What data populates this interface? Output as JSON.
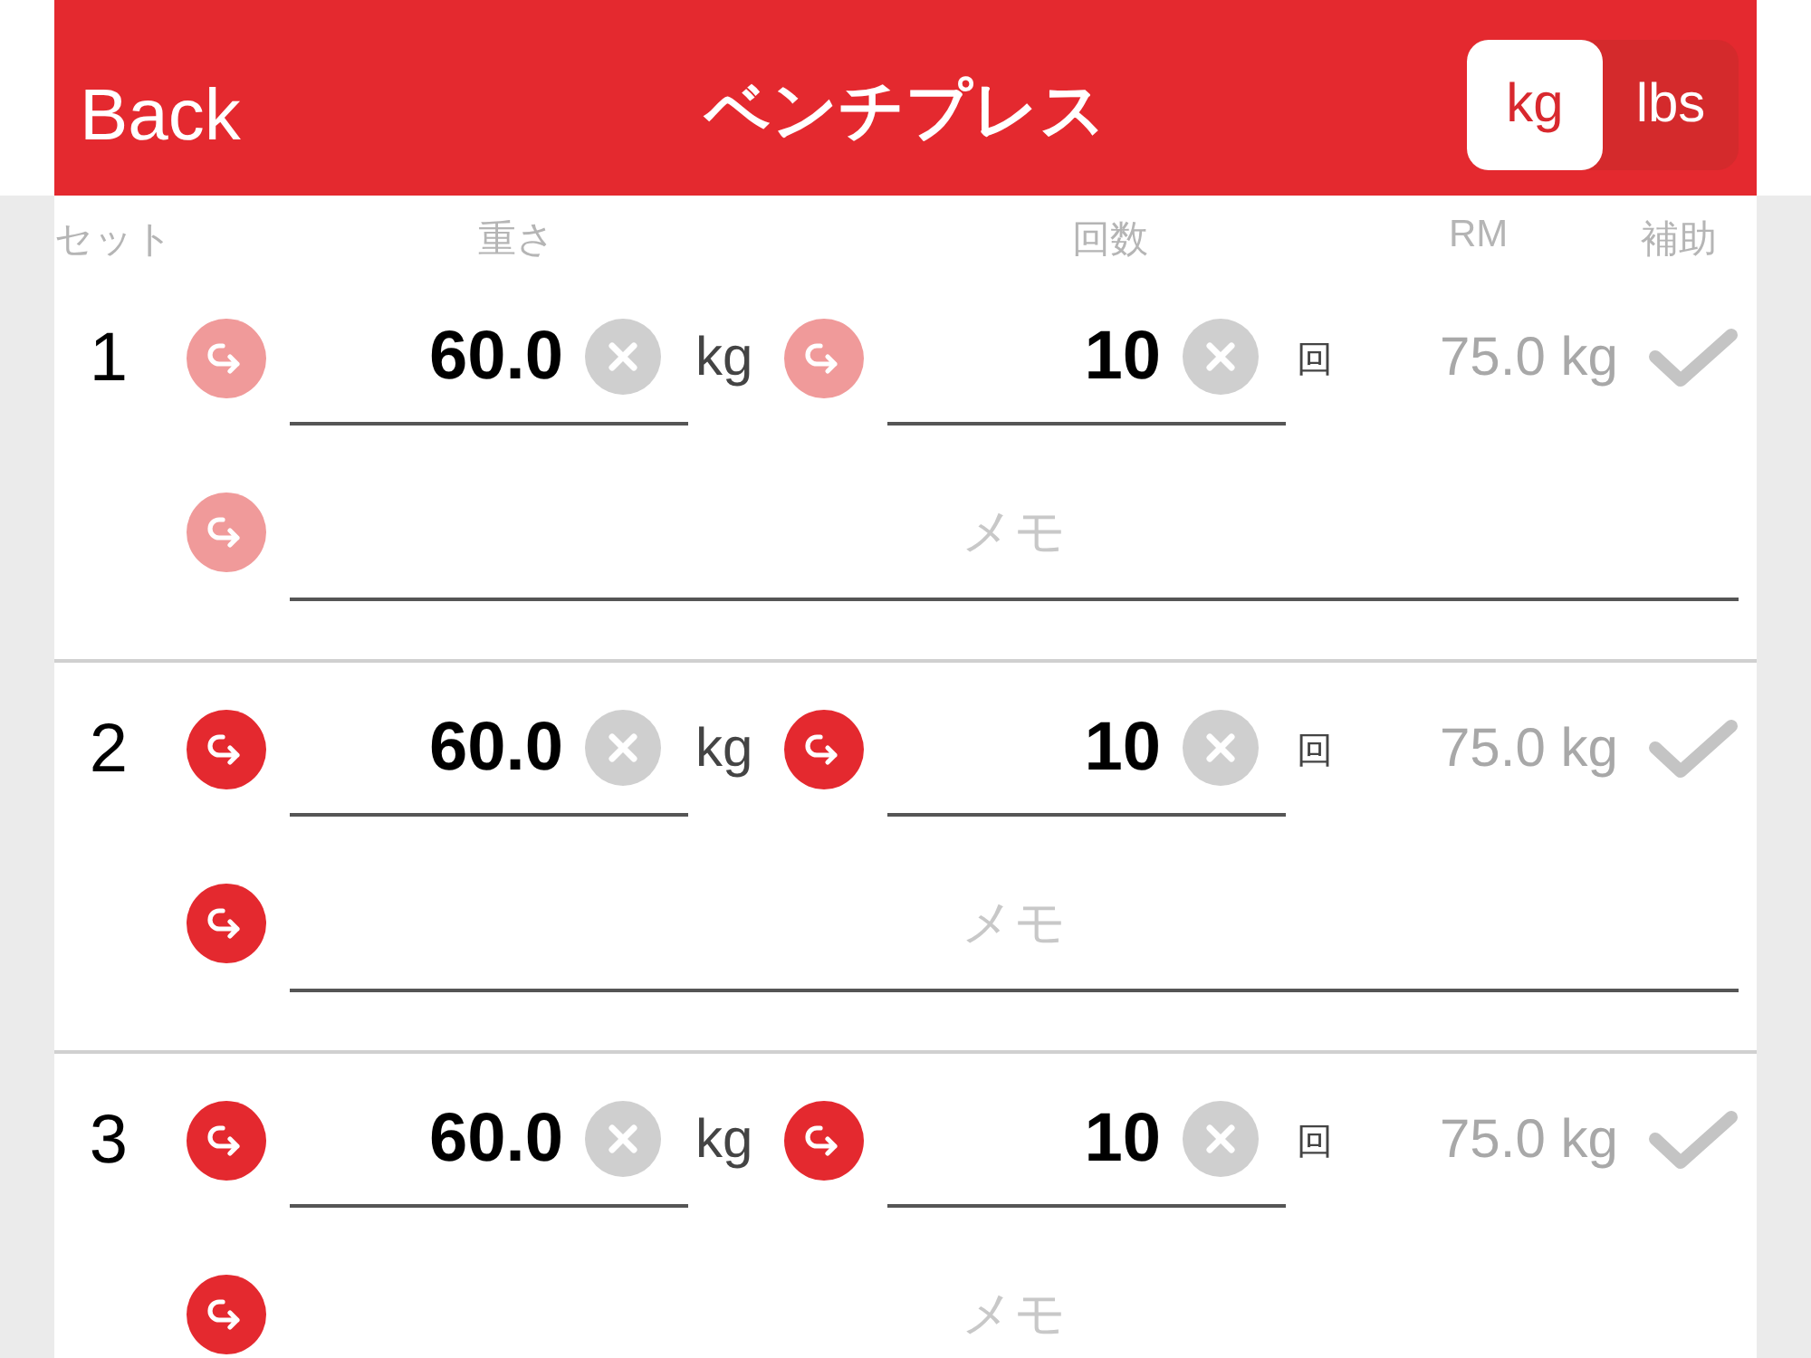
{
  "header": {
    "back": "Back",
    "title": "ベンチプレス",
    "units": [
      {
        "label": "kg",
        "selected": true
      },
      {
        "label": "lbs",
        "selected": false
      }
    ]
  },
  "columns": [
    "セット",
    "重さ",
    "回数",
    "RM",
    "補助"
  ],
  "sets": [
    {
      "number": "1",
      "disabled": true,
      "weight": "60.0",
      "weight_unit": "kg",
      "reps": "10",
      "reps_unit": "回",
      "rm": "75.0 kg",
      "checked": false,
      "memo_placeholder": "メモ"
    },
    {
      "number": "2",
      "disabled": false,
      "weight": "60.0",
      "weight_unit": "kg",
      "reps": "10",
      "reps_unit": "回",
      "rm": "75.0 kg",
      "checked": false,
      "memo_placeholder": "メモ"
    },
    {
      "number": "3",
      "disabled": false,
      "weight": "60.0",
      "weight_unit": "kg",
      "reps": "10",
      "reps_unit": "回",
      "rm": "75.0 kg",
      "checked": false,
      "memo_placeholder": "メモ"
    }
  ]
}
